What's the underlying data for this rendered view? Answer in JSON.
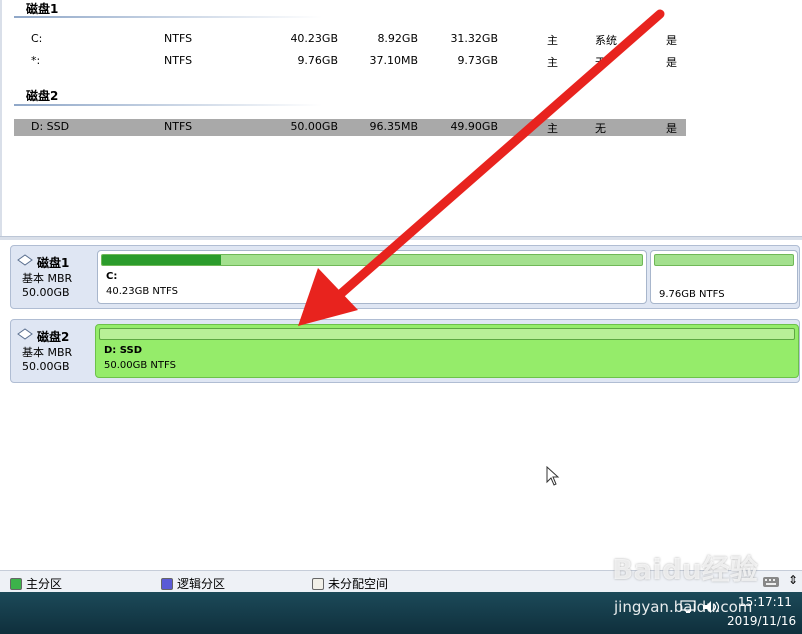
{
  "partition_list": {
    "groups": [
      {
        "name": "磁盘1",
        "rows": [
          {
            "name": "C:",
            "fs": "NTFS",
            "capacity": "40.23GB",
            "used": "8.92GB",
            "free": "31.32GB",
            "type": "主",
            "status": "系统",
            "active": "是"
          },
          {
            "name": "*:",
            "fs": "NTFS",
            "capacity": "9.76GB",
            "used": "37.10MB",
            "free": "9.73GB",
            "type": "主",
            "status": "无",
            "active": "是"
          }
        ]
      },
      {
        "name": "磁盘2",
        "rows": [
          {
            "name": "D: SSD",
            "fs": "NTFS",
            "capacity": "50.00GB",
            "used": "96.35MB",
            "free": "49.90GB",
            "type": "主",
            "status": "无",
            "active": "是"
          }
        ]
      }
    ]
  },
  "disk_map": {
    "disks": [
      {
        "name": "磁盘1",
        "type": "基本 MBR",
        "size": "50.00GB",
        "icon": "disk-icon",
        "partitions": [
          {
            "label": "C:",
            "desc": "40.23GB NTFS",
            "used_fraction": 0.22
          },
          {
            "label": "",
            "desc": "9.76GB NTFS",
            "used_fraction": 0.0
          }
        ]
      },
      {
        "name": "磁盘2",
        "type": "基本 MBR",
        "size": "50.00GB",
        "icon": "disk-icon",
        "partitions": [
          {
            "label": "D: SSD",
            "desc": "50.00GB NTFS",
            "used_fraction": 0.0
          }
        ]
      }
    ]
  },
  "legend": {
    "items": [
      {
        "label": "主分区",
        "color": "#3cb34a"
      },
      {
        "label": "逻辑分区",
        "color": "#5a5ad6"
      },
      {
        "label": "未分配空间",
        "color": "#f2f0e8"
      }
    ]
  },
  "taskbar": {
    "time": "15:17:11",
    "date": "2019/11/16",
    "icons": [
      "network-icon",
      "volume-icon",
      "keyboard-icon"
    ]
  },
  "watermark": {
    "logo": "Baidu经验",
    "url": "jingyan.baidu.com"
  },
  "colors": {
    "selected_row": "#a9a9a9",
    "selected_partition": "#95ec6a",
    "used_fill": "#2c9c2c",
    "annotation_arrow": "#e8231e"
  }
}
